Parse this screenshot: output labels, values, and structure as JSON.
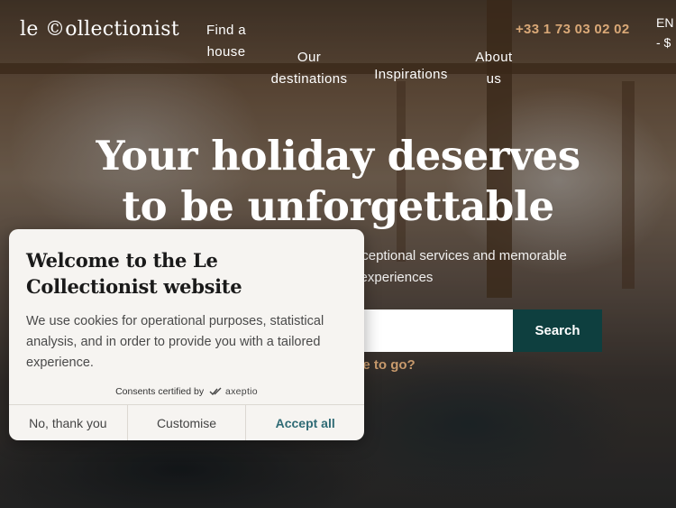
{
  "header": {
    "logo": "le ©ollectionist",
    "nav": [
      {
        "label": "Find a house"
      },
      {
        "label": "Our destinations"
      },
      {
        "label": "Inspirations"
      },
      {
        "label": "About us"
      }
    ],
    "phone": "+33 1 73 03 02 02",
    "language": "EN",
    "currency": "- $"
  },
  "hero": {
    "headline_line1": "Your holiday deserves",
    "headline_line2": "to be unforgettable",
    "subline": "…ul houses to rent, exceptional services and memorable experiences",
    "search_placeholder": "",
    "search_button": "Search",
    "dont_know": "Don't know where to go?"
  },
  "cookie_banner": {
    "title": "Welcome to the Le Collectionist website",
    "text": "We use cookies for operational purposes, statistical analysis, and in order to provide you with a tailored experience.",
    "certified_prefix": "Consents certified by",
    "certified_brand": "axeptio",
    "reject": "No, thank you",
    "customise": "Customise",
    "accept": "Accept all"
  },
  "colors": {
    "accent_gold": "#d9a877",
    "search_button_bg": "#0e3f3f",
    "accept_text": "#2f6b75"
  },
  "icons": [
    "axeptio-logo-icon"
  ]
}
